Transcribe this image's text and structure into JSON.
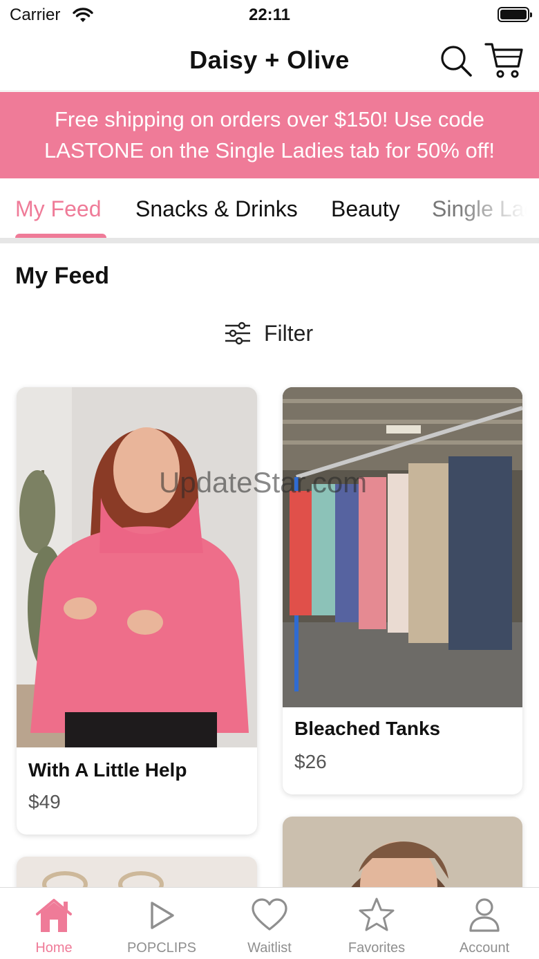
{
  "status_bar": {
    "carrier": "Carrier",
    "time": "22:11"
  },
  "header": {
    "title": "Daisy + Olive"
  },
  "promo": {
    "line1": "Free shipping on orders over $150! Use code",
    "line2": "LASTONE on the Single Ladies tab for 50% off!"
  },
  "tabs": [
    {
      "label": "My Feed",
      "active": true
    },
    {
      "label": "Snacks & Drinks",
      "active": false
    },
    {
      "label": "Beauty",
      "active": false
    },
    {
      "label": "Single Ladies",
      "active": false
    }
  ],
  "feed": {
    "title": "My Feed",
    "filter_label": "Filter",
    "products": [
      {
        "name": "With A Little Help",
        "price": "$49"
      },
      {
        "name": "Bleached Tanks",
        "price": "$26"
      }
    ]
  },
  "watermark": "UpdateStar.com",
  "bottom_nav": [
    {
      "label": "Home",
      "icon": "home-icon",
      "active": true
    },
    {
      "label": "POPCLIPS",
      "icon": "play-icon",
      "active": false
    },
    {
      "label": "Waitlist",
      "icon": "heart-icon",
      "active": false
    },
    {
      "label": "Favorites",
      "icon": "star-icon",
      "active": false
    },
    {
      "label": "Account",
      "icon": "user-icon",
      "active": false
    }
  ],
  "colors": {
    "brand_pink": "#ef7b98",
    "inactive_gray": "#8f8f8f"
  }
}
